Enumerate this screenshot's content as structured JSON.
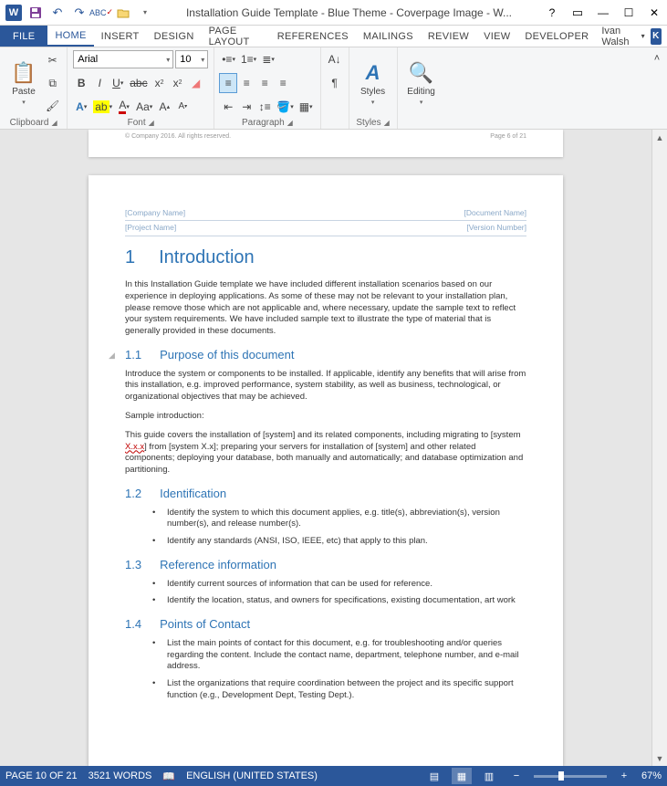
{
  "titlebar": {
    "title": "Installation Guide Template - Blue Theme - Coverpage Image - W..."
  },
  "tabs": {
    "file": "FILE",
    "home": "HOME",
    "insert": "INSERT",
    "design": "DESIGN",
    "layout": "PAGE LAYOUT",
    "references": "REFERENCES",
    "mailings": "MAILINGS",
    "review": "REVIEW",
    "view": "VIEW",
    "developer": "DEVELOPER"
  },
  "user": {
    "name": "Ivan Walsh",
    "initial": "K"
  },
  "ribbon": {
    "clipboard": {
      "paste": "Paste",
      "label": "Clipboard"
    },
    "font": {
      "name": "Arial",
      "size": "10",
      "label": "Font"
    },
    "paragraph": {
      "label": "Paragraph"
    },
    "styles": {
      "label": "Styles",
      "btn": "Styles"
    },
    "editing": {
      "label": "Editing",
      "btn": "Editing"
    }
  },
  "doc": {
    "footer_left": "© Company 2016. All rights reserved.",
    "footer_right": "Page 6 of 21",
    "header": {
      "company": "[Company Name]",
      "project": "[Project Name]",
      "docname": "[Document Name]",
      "version": "[Version Number]"
    },
    "h1_num": "1",
    "h1": "Introduction",
    "p1": "In this Installation Guide template we have included different installation scenarios based on our experience in deploying applications. As some of these may not be relevant to your installation plan, please remove those which are not applicable and, where necessary, update the sample text to reflect your system requirements. We have included sample text to illustrate the type of material that is generally provided in these documents.",
    "s1": {
      "num": "1.1",
      "title": "Purpose of this document",
      "p1": "Introduce the system or components to be installed. If applicable, identify any benefits that will arise from this installation, e.g. improved performance, system stability, as well as business, technological, or organizational objectives that may be achieved.",
      "p2": "Sample introduction:",
      "p3a": "This guide covers the installation of [system] and its related components, including migrating to [system ",
      "p3b": "X.x.x",
      "p3c": "] from [system X.x]; preparing your servers for installation of [system] and other related components; deploying your database, both manually and automatically; and database optimization and partitioning."
    },
    "s2": {
      "num": "1.2",
      "title": "Identification",
      "b1": "Identify the system to which this document applies, e.g. title(s), abbreviation(s), version number(s), and release number(s).",
      "b2": "Identify any standards (ANSI, ISO, IEEE, etc) that apply to this plan."
    },
    "s3": {
      "num": "1.3",
      "title": "Reference information",
      "b1": "Identify current sources of information that can be used for reference.",
      "b2": "Identify the location, status, and owners for specifications, existing documentation, art work"
    },
    "s4": {
      "num": "1.4",
      "title": "Points of Contact",
      "b1": "List the main points of contact for this document, e.g. for troubleshooting and/or queries regarding the content. Include the contact name, department, telephone number, and e-mail address.",
      "b2": "List the organizations that require coordination between the project and its specific support function (e.g., Development Dept, Testing Dept.)."
    }
  },
  "status": {
    "page": "PAGE 10 OF 21",
    "words": "3521 WORDS",
    "lang": "ENGLISH (UNITED STATES)",
    "zoom": "67%"
  }
}
